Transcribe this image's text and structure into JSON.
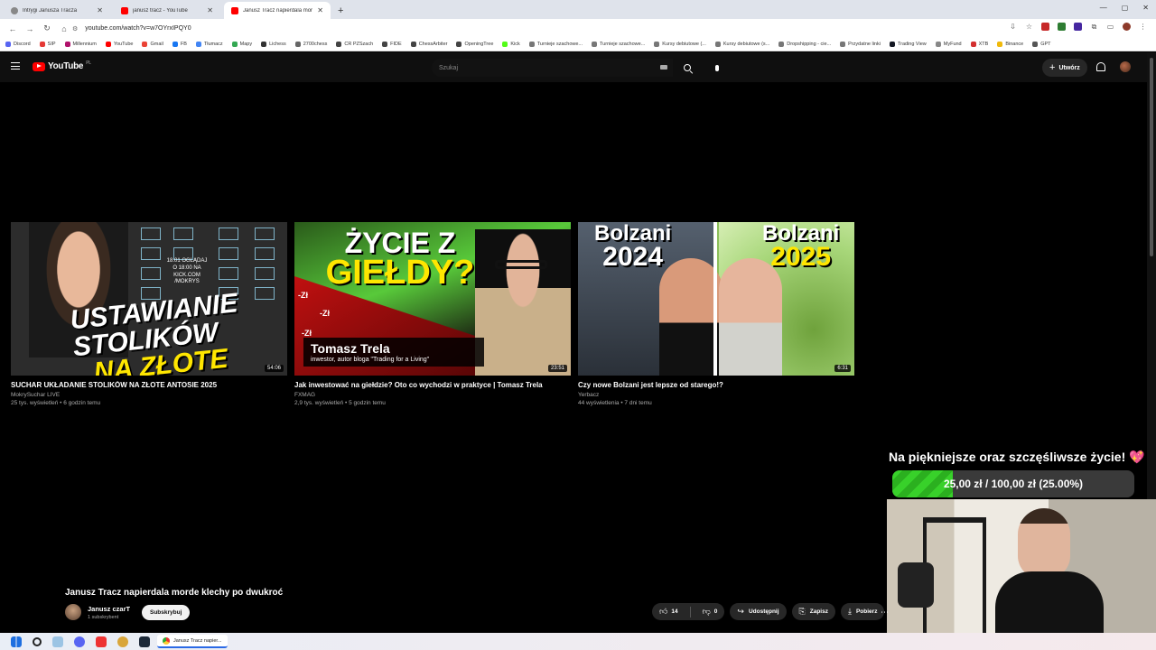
{
  "browser": {
    "tabs": [
      {
        "label": "Intrygi Janusza Tracza",
        "color": "#888888"
      },
      {
        "label": "janusz tracz - YouTube",
        "color": "#ff0000"
      },
      {
        "label": "Janusz Tracz napierdala morde",
        "color": "#ff0000"
      }
    ],
    "url": "youtube.com/watch?v=w7OYrxIPQY0",
    "bookmarks": [
      {
        "label": "Discord",
        "color": "#5865f2"
      },
      {
        "label": "SIP",
        "color": "#e53935"
      },
      {
        "label": "Millennium",
        "color": "#b0126b"
      },
      {
        "label": "YouTube",
        "color": "#ff0000"
      },
      {
        "label": "Gmail",
        "color": "#ea4335"
      },
      {
        "label": "FB",
        "color": "#1877f2"
      },
      {
        "label": "Tłumacz",
        "color": "#4285f4"
      },
      {
        "label": "Mapy",
        "color": "#34a853"
      },
      {
        "label": "Lichess",
        "color": "#333333"
      },
      {
        "label": "2700chess",
        "color": "#666666"
      },
      {
        "label": "CR PZSzach",
        "color": "#444444"
      },
      {
        "label": "FIDE",
        "color": "#444444"
      },
      {
        "label": "ChessArbiter",
        "color": "#444444"
      },
      {
        "label": "OpeningTree",
        "color": "#444444"
      },
      {
        "label": "Kick",
        "color": "#53fc18"
      },
      {
        "label": "Turnieje szachowe...",
        "color": "#777777"
      },
      {
        "label": "Turnieje szachowe...",
        "color": "#777777"
      },
      {
        "label": "Kursy debiutowe (...",
        "color": "#777777"
      },
      {
        "label": "Kursy debiutowe (s...",
        "color": "#777777"
      },
      {
        "label": "Dropshipping - cie...",
        "color": "#777777"
      },
      {
        "label": "Przydatne linki",
        "color": "#777777"
      },
      {
        "label": "Trading View",
        "color": "#131722"
      },
      {
        "label": "MyFund",
        "color": "#888888"
      },
      {
        "label": "XTB",
        "color": "#d32f2f"
      },
      {
        "label": "Binance",
        "color": "#f0b90b"
      },
      {
        "label": "GPT",
        "color": "#555555"
      }
    ]
  },
  "youtube": {
    "logo_text": "YouTube",
    "logo_region": "PL",
    "search_placeholder": "Szukaj",
    "create_label": "Utwórz"
  },
  "end_screen": {
    "videos": [
      {
        "title": "SUCHAR UKŁADANIE STOLIKÓW NA ZŁOTE ANTOSIE 2025",
        "channel": "MokrySuchar LIVE",
        "meta": "25 tys. wyświetleń • 6 godzin temu",
        "duration": "54:06",
        "thumb_line1": "USTAWIANIE STOLIKÓW",
        "thumb_line2": "NA ZŁOTE ANTOSIE",
        "thumb_side": "18.01 OGLĄDAJ O 18:00 NA KICK.COM /MOKRYS"
      },
      {
        "title": "Jak inwestować na giełdzie? Oto co wychodzi w praktyce | Tomasz Trela",
        "channel": "FXMAG",
        "meta": "2,9 tys. wyświetleń • 5 godzin temu",
        "duration": "23:51",
        "thumb_line1": "ŻYCIE Z",
        "thumb_line2": "GIEŁDY?",
        "thumb_name": "Tomasz Trela",
        "thumb_desc": "inwestor, autor bloga \"Trading for a Living\"",
        "thumb_minus": "-Zł"
      },
      {
        "title": "Czy nowe Bolzani jest lepsze od starego!?",
        "channel": "Yerbacz",
        "meta": "44 wyświetlenia • 7 dni temu",
        "duration": "6:31",
        "thumb_left_word": "Bolzani",
        "thumb_left_year": "2024",
        "thumb_right_word": "Bolzani",
        "thumb_right_year": "2025"
      }
    ]
  },
  "overlay": {
    "goal_title": "Na piękniejsze oraz szczęśliwsze życie! 💖",
    "goal_text": "25,00 zł / 100,00 zł (25.00%)",
    "goal_fraction": 0.25,
    "bar_color": "#38d12a"
  },
  "video": {
    "title": "Janusz Tracz napierdala morde klechy po dwukroć",
    "channel_name": "Janusz czarT",
    "subscribers": "1 subskrybent",
    "subscribe_label": "Subskrybuj",
    "likes": "14",
    "dislikes": "0",
    "share_label": "Udostępnij",
    "save_label": "Zapisz",
    "download_label": "Pobierz"
  },
  "taskbar": {
    "active_app": "Janusz Tracz napier..."
  }
}
